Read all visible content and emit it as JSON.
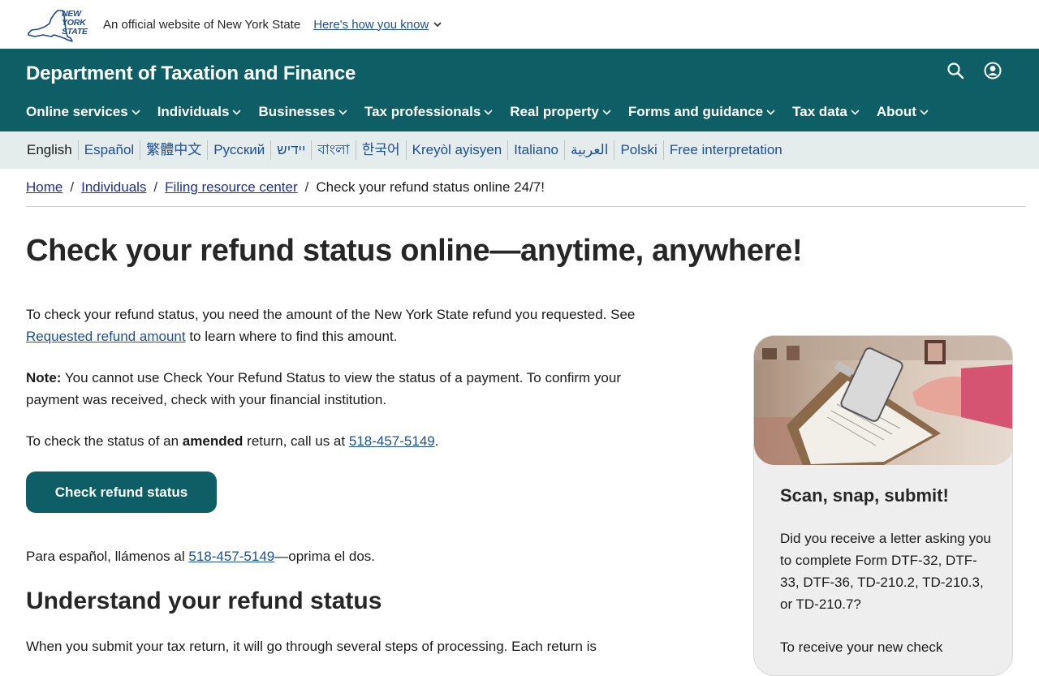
{
  "banner": {
    "logo_text": [
      "NEW",
      "YORK",
      "STATE"
    ],
    "official": "An official website of New York State",
    "how_know": "Here's how you know"
  },
  "header": {
    "title": "Department of Taxation and Finance",
    "icons": [
      "search-icon",
      "account-icon"
    ],
    "nav": [
      "Online services",
      "Individuals",
      "Businesses",
      "Tax professionals",
      "Real property",
      "Forms and guidance",
      "Tax data",
      "About"
    ]
  },
  "languages": [
    "English",
    "Español",
    "繁體中文",
    "Русский",
    "יידיש",
    "বাংলা",
    "한국어",
    "Kreyòl ayisyen",
    "Italiano",
    "العربية",
    "Polski",
    "Free interpretation"
  ],
  "breadcrumb": {
    "home": "Home",
    "individuals": "Individuals",
    "filing": "Filing resource center",
    "current": "Check your refund status online 24/7!",
    "separator": "/"
  },
  "page_title": "Check your refund status online—anytime, anywhere!",
  "content": {
    "p1_a": "To check your refund status, you need the amount of the New York State refund you requested. See",
    "p1_link": "Requested refund amount",
    "p1_b": "to learn where to find this amount.",
    "p2_label": "Note:",
    "p2_text": "You cannot use Check Your Refund Status to view the status of a payment. To confirm your payment was received, check with your financial institution.",
    "p3_a": "To check the status of an",
    "p3_bold": "amended",
    "p3_b": "return, call us at",
    "p3_phone": "518-457-5149",
    "p3_end": ".",
    "button": "Check refund status",
    "spanish_a": "Para español, llámenos al",
    "spanish_phone": "518-457-5149",
    "spanish_b": "—oprima el dos.",
    "h2": "Understand your refund status",
    "cut_text": "When you submit your tax return, it will go through several steps of processing. Each return is"
  },
  "card": {
    "title": "Scan, snap, submit!",
    "body": "Did you receive a letter asking you to complete Form DTF-32, DTF-33, DTF-36, TD-210.2, TD-210.3, or TD-210.7?",
    "body2": "To receive your new check"
  },
  "colors": {
    "teal": "#0e5e66",
    "lang_bg": "#e4ecec",
    "link": "#1b4f9c"
  }
}
